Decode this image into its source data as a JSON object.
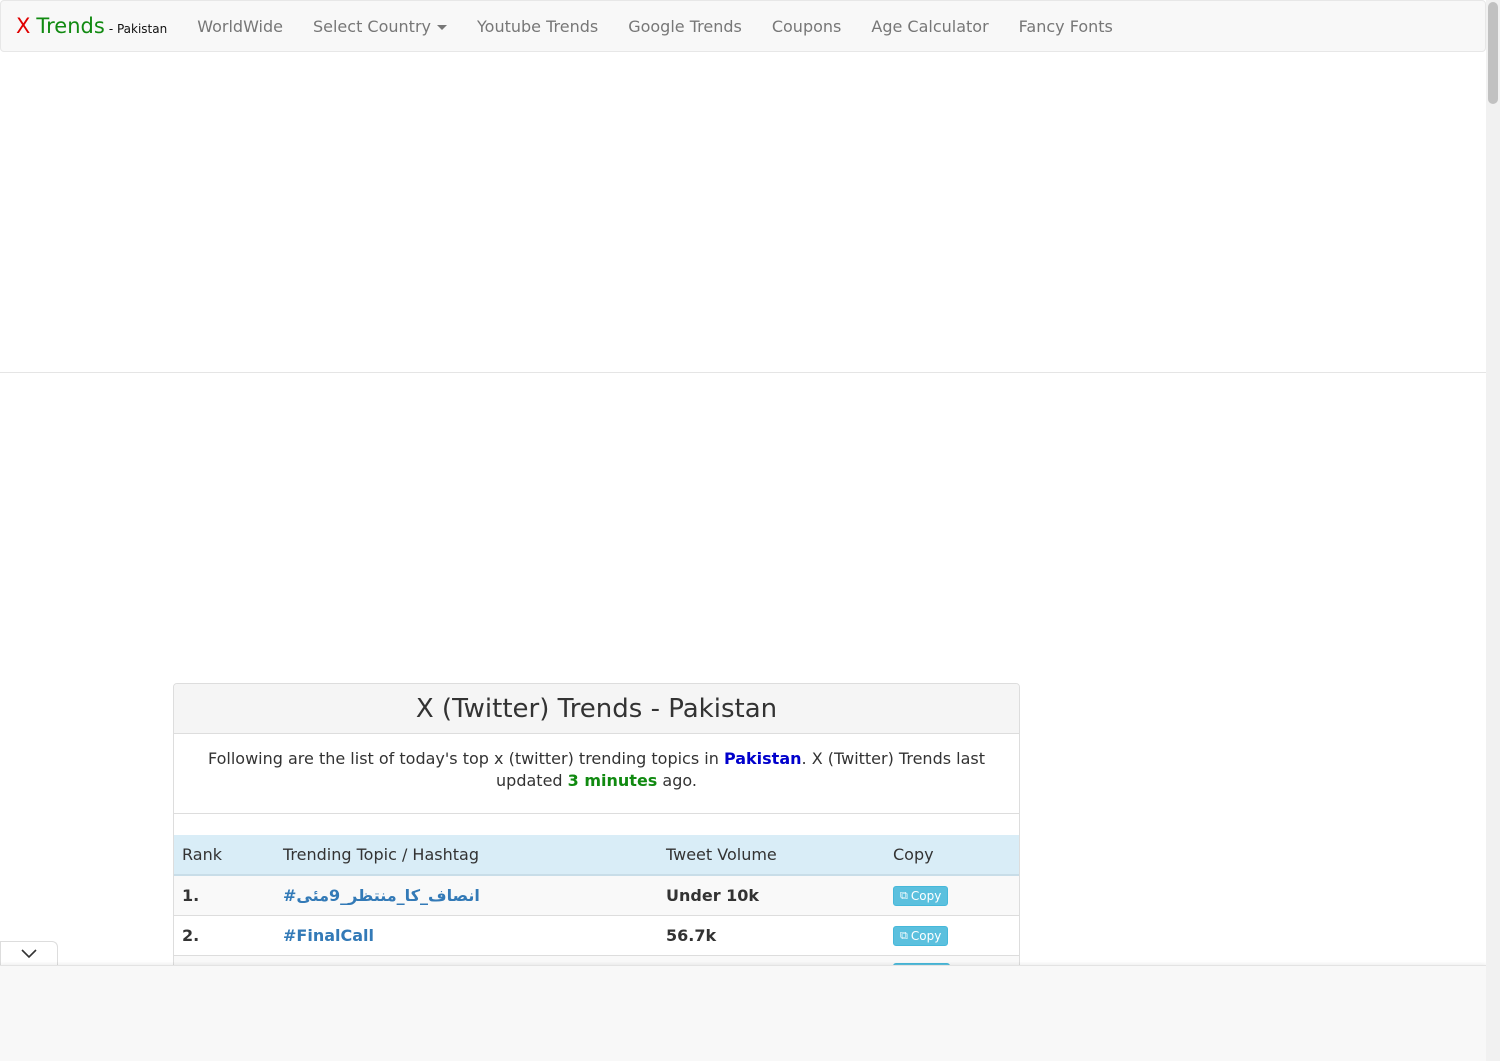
{
  "brand": {
    "x": "X",
    "trends": "Trends",
    "country": "- Pakistan"
  },
  "nav": {
    "worldwide": "WorldWide",
    "select_country": "Select Country",
    "youtube": "Youtube Trends",
    "google": "Google Trends",
    "coupons": "Coupons",
    "age": "Age Calculator",
    "fonts": "Fancy Fonts"
  },
  "panel": {
    "title": "X (Twitter) Trends - Pakistan",
    "desc_before": "Following are the list of today's top x (twitter) trending topics in ",
    "country": "Pakistan",
    "desc_middle": ". X (Twitter) Trends last updated ",
    "time_ago": "3 minutes",
    "desc_after": " ago."
  },
  "table": {
    "headers": [
      "Rank",
      "Trending Topic / Hashtag",
      "Tweet Volume",
      "Copy"
    ],
    "rows": [
      {
        "rank": "1.",
        "topic": "#انصاف_کا_منتظر_9مئی",
        "volume": "Under 10k",
        "copy": "Copy"
      },
      {
        "rank": "2.",
        "topic": "#FinalCall",
        "volume": "56.7k",
        "copy": "Copy"
      }
    ]
  },
  "colors": {
    "brand_x": "#e00000",
    "brand_trends": "#118a11",
    "link": "#337ab7",
    "copy_btn": "#5bc0de",
    "header_row": "#d9edf7"
  }
}
